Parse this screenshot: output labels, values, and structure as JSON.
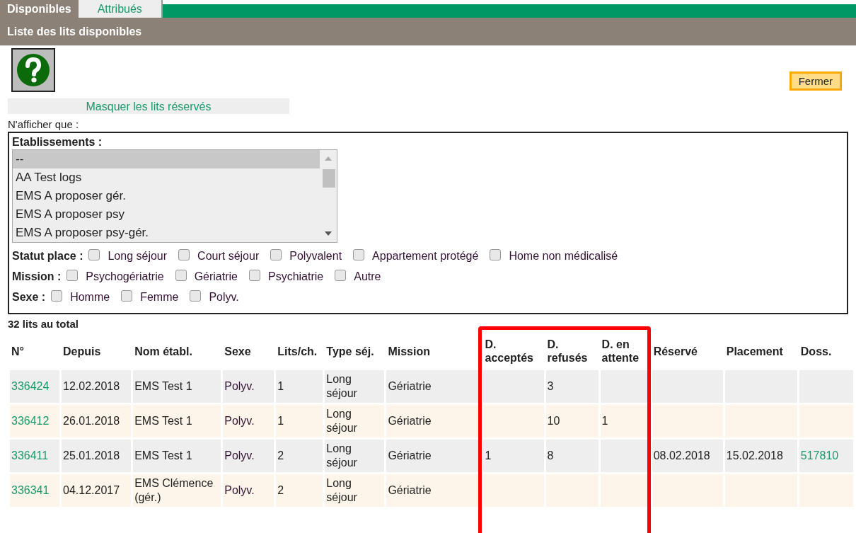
{
  "tabs": [
    {
      "label": "Disponibles",
      "selected": true
    },
    {
      "label": "Attribués",
      "selected": false
    }
  ],
  "title": "Liste des lits disponibles",
  "close_button": "Fermer",
  "toggle_link": "Masquer les lits réservés",
  "filter_intro": "N'afficher que :",
  "filters": {
    "establishments": {
      "label": "Etablissements :",
      "options": [
        {
          "label": "--",
          "selected": true
        },
        {
          "label": "AA Test logs",
          "selected": false
        },
        {
          "label": "EMS A proposer gér.",
          "selected": false
        },
        {
          "label": "EMS A proposer psy",
          "selected": false
        },
        {
          "label": "EMS A proposer psy-gér.",
          "selected": false
        }
      ]
    },
    "groups": [
      {
        "label": "Statut place :",
        "options": [
          {
            "label": "Long séjour",
            "checked": false
          },
          {
            "label": "Court séjour",
            "checked": false
          },
          {
            "label": "Polyvalent",
            "checked": false
          },
          {
            "label": "Appartement protégé",
            "checked": false
          },
          {
            "label": "Home non médicalisé",
            "checked": false
          }
        ]
      },
      {
        "label": "Mission :",
        "options": [
          {
            "label": "Psychogériatrie",
            "checked": false
          },
          {
            "label": "Gériatrie",
            "checked": false
          },
          {
            "label": "Psychiatrie",
            "checked": false
          },
          {
            "label": "Autre",
            "checked": false
          }
        ]
      },
      {
        "label": "Sexe :",
        "options": [
          {
            "label": "Homme",
            "checked": false
          },
          {
            "label": "Femme",
            "checked": false
          },
          {
            "label": "Polyv.",
            "checked": false
          }
        ]
      }
    ]
  },
  "total": "32 lits au total",
  "table": {
    "columns": [
      {
        "label": "N°",
        "kind": "link"
      },
      {
        "label": "Depuis",
        "kind": "text"
      },
      {
        "label": "Nom établ.",
        "kind": "text"
      },
      {
        "label": "Sexe",
        "kind": "text"
      },
      {
        "label": "Lits/ch.",
        "kind": "text"
      },
      {
        "label": "Type séj.",
        "kind": "text"
      },
      {
        "label": "Mission",
        "kind": "text"
      },
      {
        "label": "D. acceptés",
        "kind": "text"
      },
      {
        "label": "D. refusés",
        "kind": "text"
      },
      {
        "label": "D. en attente",
        "kind": "text"
      },
      {
        "label": "Réservé",
        "kind": "text"
      },
      {
        "label": "Placement",
        "kind": "text"
      },
      {
        "label": "Doss.",
        "kind": "link"
      }
    ],
    "rows": [
      {
        "cells": [
          "336424",
          "12.02.2018",
          "EMS Test 1",
          "Polyv.",
          "1",
          "Long séjour",
          "Gériatrie",
          null,
          "3",
          null,
          null,
          null,
          null
        ]
      },
      {
        "cells": [
          "336412",
          "26.01.2018",
          "EMS Test 1",
          "Polyv.",
          "1",
          "Long séjour",
          "Gériatrie",
          null,
          "10",
          "1",
          null,
          null,
          null
        ]
      },
      {
        "cells": [
          "336411",
          "25.01.2018",
          "EMS Test 1",
          "Polyv.",
          "2",
          "Long séjour",
          "Gériatrie",
          "1",
          "8",
          null,
          "08.02.2018",
          "15.02.2018",
          "517810"
        ]
      },
      {
        "cells": [
          "336341",
          "04.12.2017",
          "EMS Clémence (gér.)",
          "Polyv.",
          "2",
          "Long séjour",
          "Gériatrie",
          null,
          null,
          null,
          null,
          null,
          null
        ]
      }
    ]
  }
}
